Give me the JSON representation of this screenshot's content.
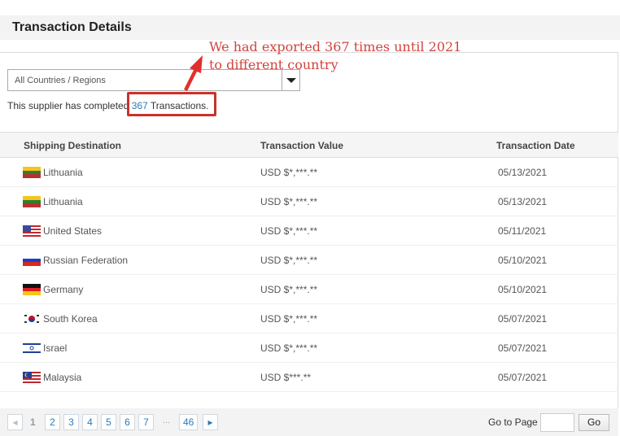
{
  "header": {
    "title": "Transaction Details"
  },
  "filter": {
    "selected": "All Countries / Regions"
  },
  "summary": {
    "prefix": "This supplier has completed ",
    "count": "367",
    "suffix": " Transactions."
  },
  "annotation": {
    "line1": "We had exported 367 times until 2021",
    "line2": "to different country",
    "color": "#d0443e"
  },
  "table": {
    "columns": [
      "Shipping Destination",
      "Transaction Value",
      "Transaction Date"
    ],
    "rows": [
      {
        "country": "Lithuania",
        "flag": "lithuania-flag",
        "value": "USD $*,***.**",
        "date": "05/13/2021"
      },
      {
        "country": "Lithuania",
        "flag": "lithuania-flag",
        "value": "USD $*,***.**",
        "date": "05/13/2021"
      },
      {
        "country": "United States",
        "flag": "usa-flag",
        "value": "USD $*,***.**",
        "date": "05/11/2021"
      },
      {
        "country": "Russian Federation",
        "flag": "russia-flag",
        "value": "USD $*,***.**",
        "date": "05/10/2021"
      },
      {
        "country": "Germany",
        "flag": "germany-flag",
        "value": "USD $*,***.**",
        "date": "05/10/2021"
      },
      {
        "country": "South Korea",
        "flag": "south-korea-flag",
        "value": "USD $*,***.**",
        "date": "05/07/2021"
      },
      {
        "country": "Israel",
        "flag": "israel-flag",
        "value": "USD $*,***.**",
        "date": "05/07/2021"
      },
      {
        "country": "Malaysia",
        "flag": "malaysia-flag",
        "value": "USD $***.**",
        "date": "05/07/2021"
      }
    ]
  },
  "pagination": {
    "current": "1",
    "pages": [
      "2",
      "3",
      "4",
      "5",
      "6",
      "7"
    ],
    "ellipsis": "...",
    "last": "46",
    "goto_label": "Go to Page",
    "goto_value": "",
    "go_label": "Go"
  },
  "colors": {
    "accent": "#2a7ab8",
    "highlight": "#c8322d"
  }
}
